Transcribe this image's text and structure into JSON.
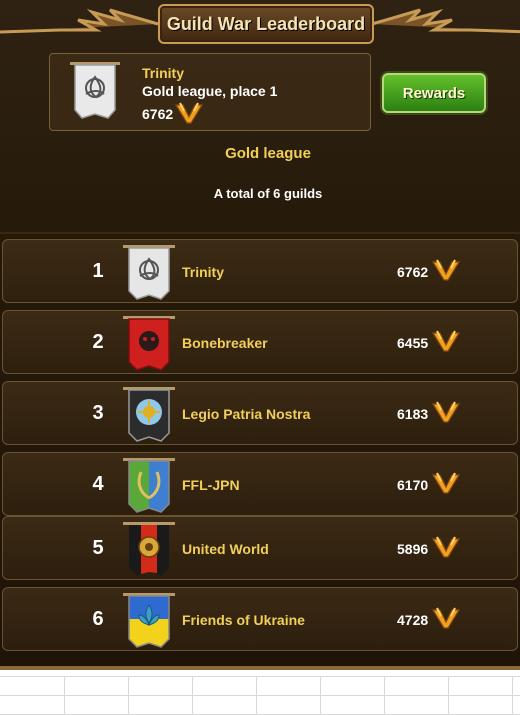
{
  "header": {
    "title": "Guild War Leaderboard"
  },
  "my_guild": {
    "name": "Trinity",
    "league_place": "Gold league, place 1",
    "score": "6762",
    "banner": "trinity-banner"
  },
  "rewards_button": {
    "label": "Rewards"
  },
  "league_name": "Gold league",
  "total_guilds": "A total of 6 guilds",
  "colors": {
    "gold_text": "#f2cf5a",
    "button_green": "#3f9e1c",
    "panel_bg": "#241909"
  },
  "guilds": [
    {
      "rank": "1",
      "name": "Trinity",
      "score": "6762",
      "banner": "white-triquetra-banner"
    },
    {
      "rank": "2",
      "name": "Bonebreaker",
      "score": "6455",
      "banner": "red-beast-banner"
    },
    {
      "rank": "3",
      "name": "Legio Patria Nostra",
      "score": "6183",
      "banner": "black-sun-banner"
    },
    {
      "rank": "4",
      "name": "FFL-JPN",
      "score": "6170",
      "banner": "green-blue-laurel-banner"
    },
    {
      "rank": "5",
      "name": "United World",
      "score": "5896",
      "banner": "black-red-emblem-banner"
    },
    {
      "rank": "6",
      "name": "Friends of Ukraine",
      "score": "4728",
      "banner": "blue-yellow-fleur-banner"
    }
  ]
}
